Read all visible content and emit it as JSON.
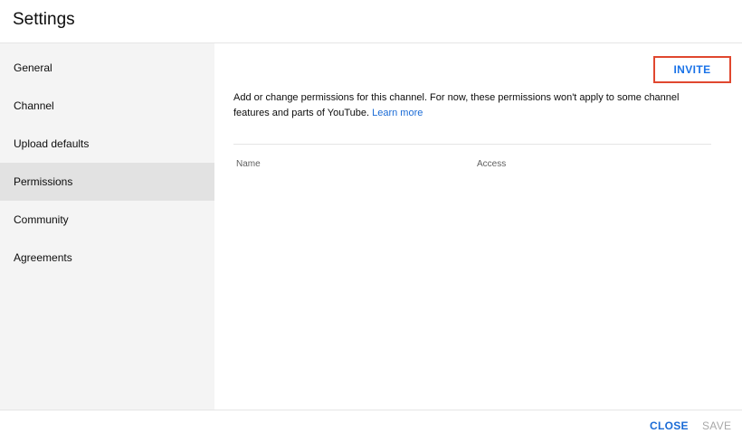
{
  "header": {
    "title": "Settings"
  },
  "sidebar": {
    "items": [
      {
        "label": "General"
      },
      {
        "label": "Channel"
      },
      {
        "label": "Upload defaults"
      },
      {
        "label": "Permissions"
      },
      {
        "label": "Community"
      },
      {
        "label": "Agreements"
      }
    ],
    "active": "Permissions"
  },
  "permissions": {
    "invite_label": "INVITE",
    "description": "Add or change permissions for this channel. For now, these permissions won't apply to some channel features and parts of YouTube.",
    "learn_more": "Learn more",
    "columns": {
      "name": "Name",
      "access": "Access"
    }
  },
  "footer": {
    "close_label": "CLOSE",
    "save_label": "SAVE"
  },
  "colors": {
    "accent": "#1a73e8",
    "highlight_border": "#e0472f",
    "sidebar_bg": "#f4f4f4",
    "sidebar_active_bg": "#e2e2e2",
    "disabled_text": "#a8a8a8"
  }
}
